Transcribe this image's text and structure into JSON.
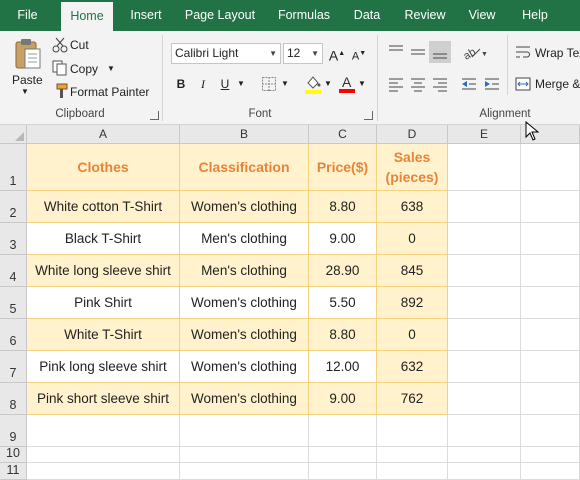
{
  "tabs": [
    {
      "label": "File",
      "active": false
    },
    {
      "label": "Home",
      "active": true
    },
    {
      "label": "Insert",
      "active": false
    },
    {
      "label": "Page Layout",
      "active": false
    },
    {
      "label": "Formulas",
      "active": false
    },
    {
      "label": "Data",
      "active": false
    },
    {
      "label": "Review",
      "active": false
    },
    {
      "label": "View",
      "active": false
    },
    {
      "label": "Help",
      "active": false
    }
  ],
  "clipboard": {
    "paste": "Paste",
    "cut": "Cut",
    "copy": "Copy",
    "format_painter": "Format Painter",
    "group": "Clipboard"
  },
  "font": {
    "name": "Calibri Light",
    "size": "12",
    "group": "Font",
    "bold": "B",
    "italic": "I",
    "underline": "U",
    "grow": "A",
    "shrink": "A",
    "color_letter": "A"
  },
  "alignment": {
    "wrap_text": "Wrap Tex",
    "merge": "Merge &",
    "group": "Alignment"
  },
  "colors": {
    "ribbon_green": "#217346",
    "header_text": "#e8833a",
    "fill": "#fff2cc",
    "table_border": "#f5d27e",
    "highlight_yellow": "#ffff00",
    "font_red": "#ff0000"
  },
  "sheet": {
    "columns": [
      "A",
      "B",
      "C",
      "D",
      "E"
    ],
    "rows": [
      "1",
      "2",
      "3",
      "4",
      "5",
      "6",
      "7",
      "8",
      "9",
      "10",
      "11"
    ],
    "header": [
      "Clothes",
      "Classification",
      "Price($)",
      "Sales (pieces)"
    ],
    "data": [
      [
        "White cotton T-Shirt",
        "Women's clothing",
        "8.80",
        "638"
      ],
      [
        "Black T-Shirt",
        "Men's clothing",
        "9.00",
        "0"
      ],
      [
        "White long sleeve shirt",
        "Men's clothing",
        "28.90",
        "845"
      ],
      [
        "Pink Shirt",
        "Women's clothing",
        "5.50",
        "892"
      ],
      [
        "White T-Shirt",
        "Women's clothing",
        "8.80",
        "0"
      ],
      [
        "Pink long sleeve shirt",
        "Women's clothing",
        "12.00",
        "632"
      ],
      [
        "Pink short sleeve shirt",
        "Women's clothing",
        "9.00",
        "762"
      ]
    ]
  }
}
